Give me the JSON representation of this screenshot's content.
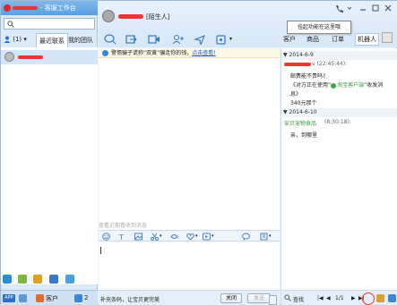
{
  "window": {
    "title": "- 客服工作台"
  },
  "left_panel": {
    "tabs": {
      "user_count": "(1)",
      "recent": "最近联系",
      "team": "我的团队"
    },
    "bottom": {
      "app_badge": "APP",
      "customers": "客户",
      "message_count": "2"
    }
  },
  "header": {
    "contact_tag": "[陌生人]",
    "tooltip": "挂起功能在这里哦",
    "right_tabs": [
      "客户",
      "商品",
      "订单",
      "机器人"
    ]
  },
  "chat": {
    "notice": "警惕骗子谎称“双黄”骗走你的钱，",
    "notice_link": "点击查看!",
    "history_hint": "查看近期看收到消息",
    "input_hint": "补充条码，让宝贝更完美",
    "close_button": "关闭",
    "send_button": "发送"
  },
  "history": {
    "date1": "2014-6-9",
    "msg1_time": "v (22:45:44):",
    "msg1_line1": "邮费能不贵吗?",
    "msg1_line2": "《对方正在使用“",
    "msg1_line2_link": "淘宝客户端",
    "msg1_line2_end": "”收发消",
    "msg1_line3": "息》",
    "msg1_line4": "340元那个",
    "date2": "2014-6-10",
    "msg2_sender": "安贝宠物食品",
    "msg2_time": "(8:30:18):",
    "msg2_text": "亲，到哪里",
    "find_label": "查找",
    "page": "1/1"
  },
  "colors": {
    "accent": "#5aa0e2",
    "link": "#1a56c8",
    "redaction": "#e33333",
    "sender_green": "#3a9a3a"
  }
}
